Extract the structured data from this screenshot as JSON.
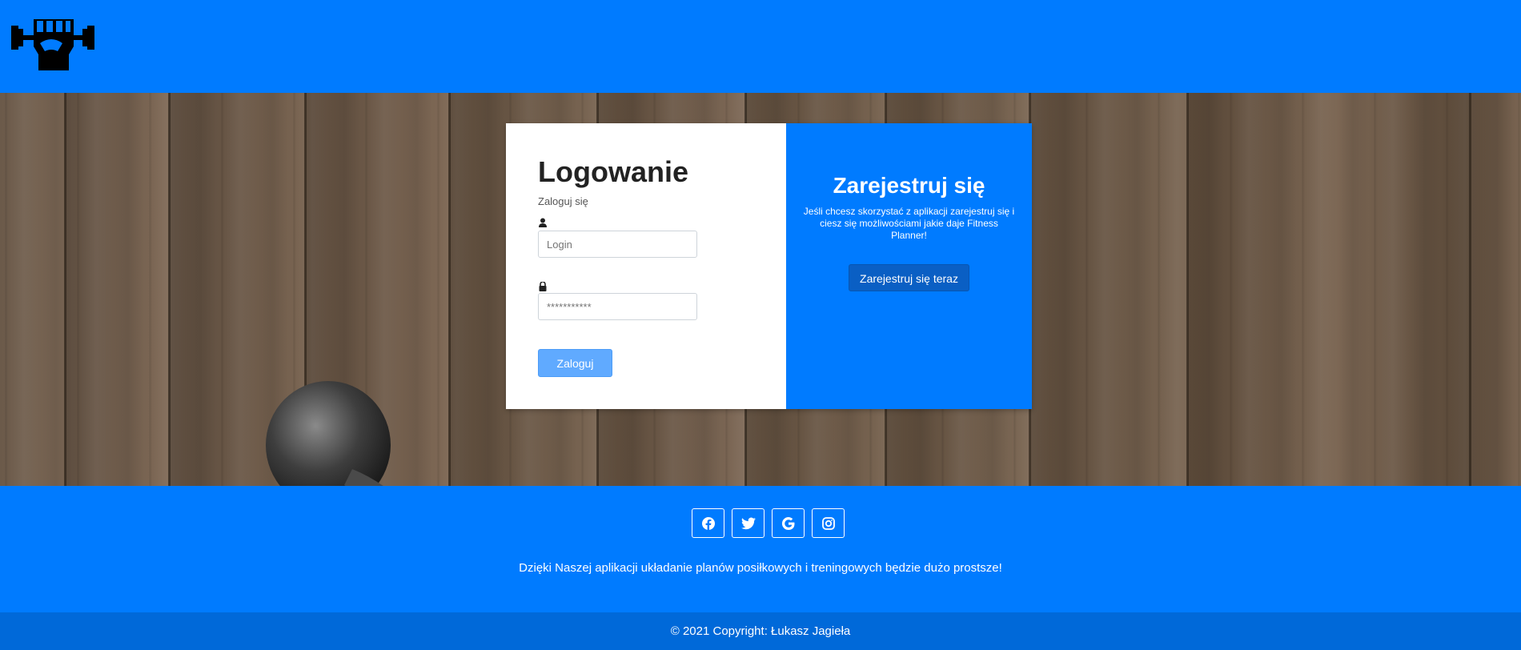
{
  "header": {
    "logo_icon": "dumbbell-fist-icon",
    "background_color": "#007bff"
  },
  "login": {
    "title": "Logowanie",
    "subtitle": "Zaloguj się",
    "login_icon": "user-icon",
    "login_placeholder": "Login",
    "password_icon": "lock-icon",
    "password_placeholder": "***********",
    "submit_label": "Zaloguj"
  },
  "register": {
    "title": "Zarejestruj się",
    "text": "Jeśli chcesz skorzystać z aplikacji zarejestruj się i ciesz się możliwościami jakie daje Fitness Planner!",
    "button_label": "Zarejestruj się teraz"
  },
  "footer": {
    "social": [
      "facebook-icon",
      "twitter-icon",
      "google-icon",
      "instagram-icon"
    ],
    "tagline": "Dzięki Naszej aplikacji układanie planów posiłkowych i treningowych będzie dużo prostsze!",
    "copyright": "© 2021 Copyright: Łukasz Jagieła"
  },
  "colors": {
    "primary": "#007bff",
    "primary_dark": "#0069d9",
    "login_button": "#60aaff"
  }
}
